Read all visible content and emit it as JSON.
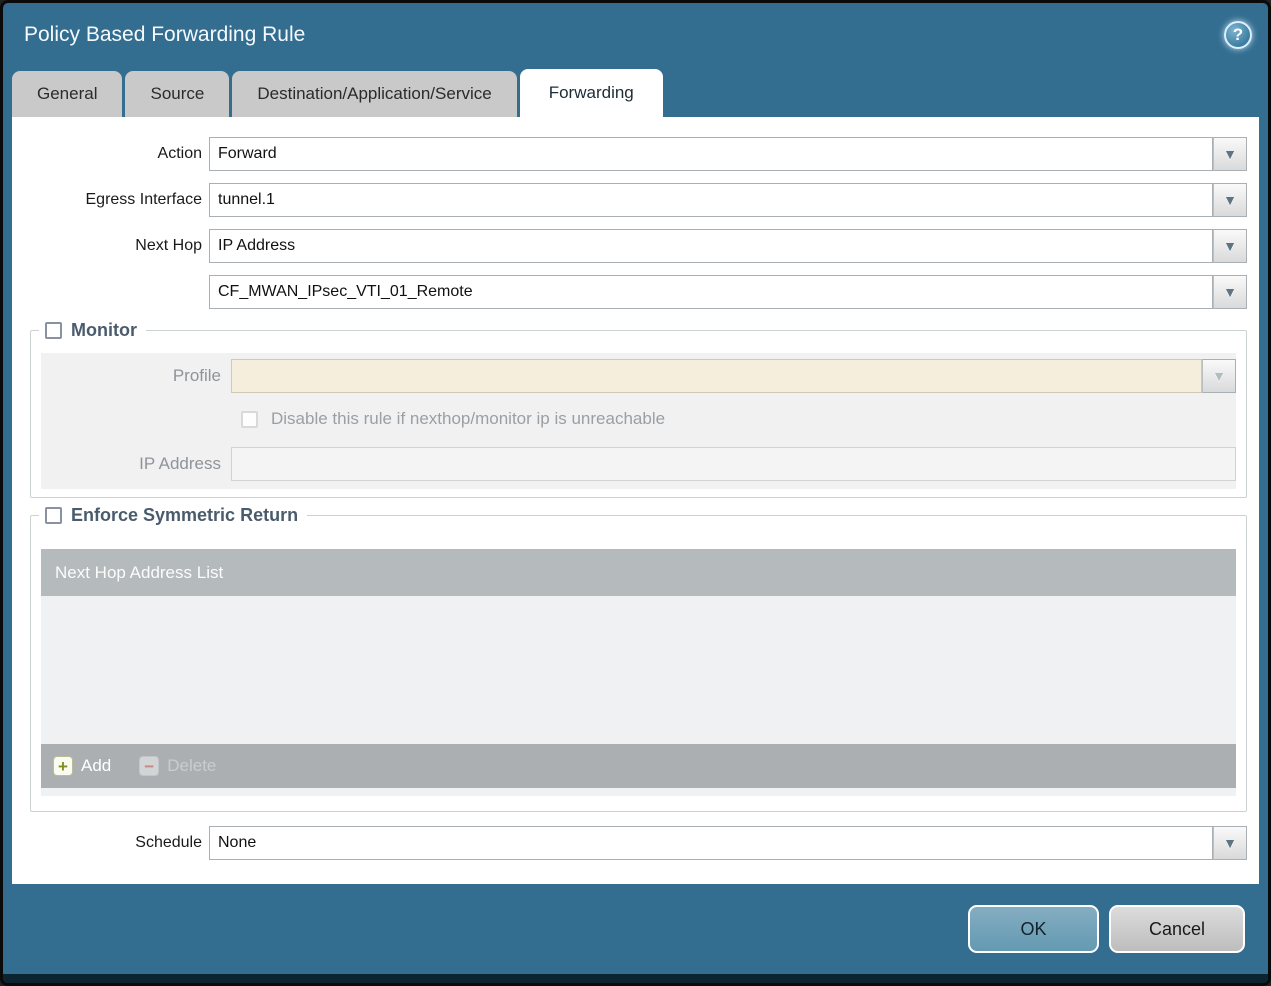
{
  "window": {
    "title": "Policy Based Forwarding Rule"
  },
  "tabs": [
    {
      "label": "General",
      "active": false
    },
    {
      "label": "Source",
      "active": false
    },
    {
      "label": "Destination/Application/Service",
      "active": false
    },
    {
      "label": "Forwarding",
      "active": true
    }
  ],
  "form": {
    "action_label": "Action",
    "action_value": "Forward",
    "egress_label": "Egress Interface",
    "egress_value": "tunnel.1",
    "next_hop_label": "Next Hop",
    "next_hop_value": "IP Address",
    "next_hop_address_value": "CF_MWAN_IPsec_VTI_01_Remote",
    "schedule_label": "Schedule",
    "schedule_value": "None"
  },
  "monitor": {
    "title": "Monitor",
    "checked": false,
    "profile_label": "Profile",
    "profile_value": "",
    "disable_rule_label": "Disable this rule if nexthop/monitor ip is unreachable",
    "disable_rule_checked": false,
    "ip_address_label": "IP Address",
    "ip_address_value": ""
  },
  "enforce_symmetric_return": {
    "title": "Enforce Symmetric Return",
    "checked": false,
    "list_header": "Next Hop Address List",
    "rows": [],
    "add_label": "Add",
    "delete_label": "Delete",
    "delete_enabled": false
  },
  "footer": {
    "ok": "OK",
    "cancel": "Cancel"
  },
  "icons": {
    "help": "?",
    "dropdown": "▼",
    "add": "+",
    "delete": "−"
  },
  "colors": {
    "dialog_teal": "#336d90",
    "active_tab_bg": "#ffffff",
    "inactive_tab_bg": "#c9c9c9",
    "section_label": "#4a5b6c",
    "disabled_field_bg": "#f5eedd",
    "table_header_bg": "#b5babd",
    "ok_button_bg": "#6fa3ba",
    "cancel_button_bg": "#c9c9c9",
    "add_plus": "#7f9023",
    "delete_minus": "#c98585"
  }
}
